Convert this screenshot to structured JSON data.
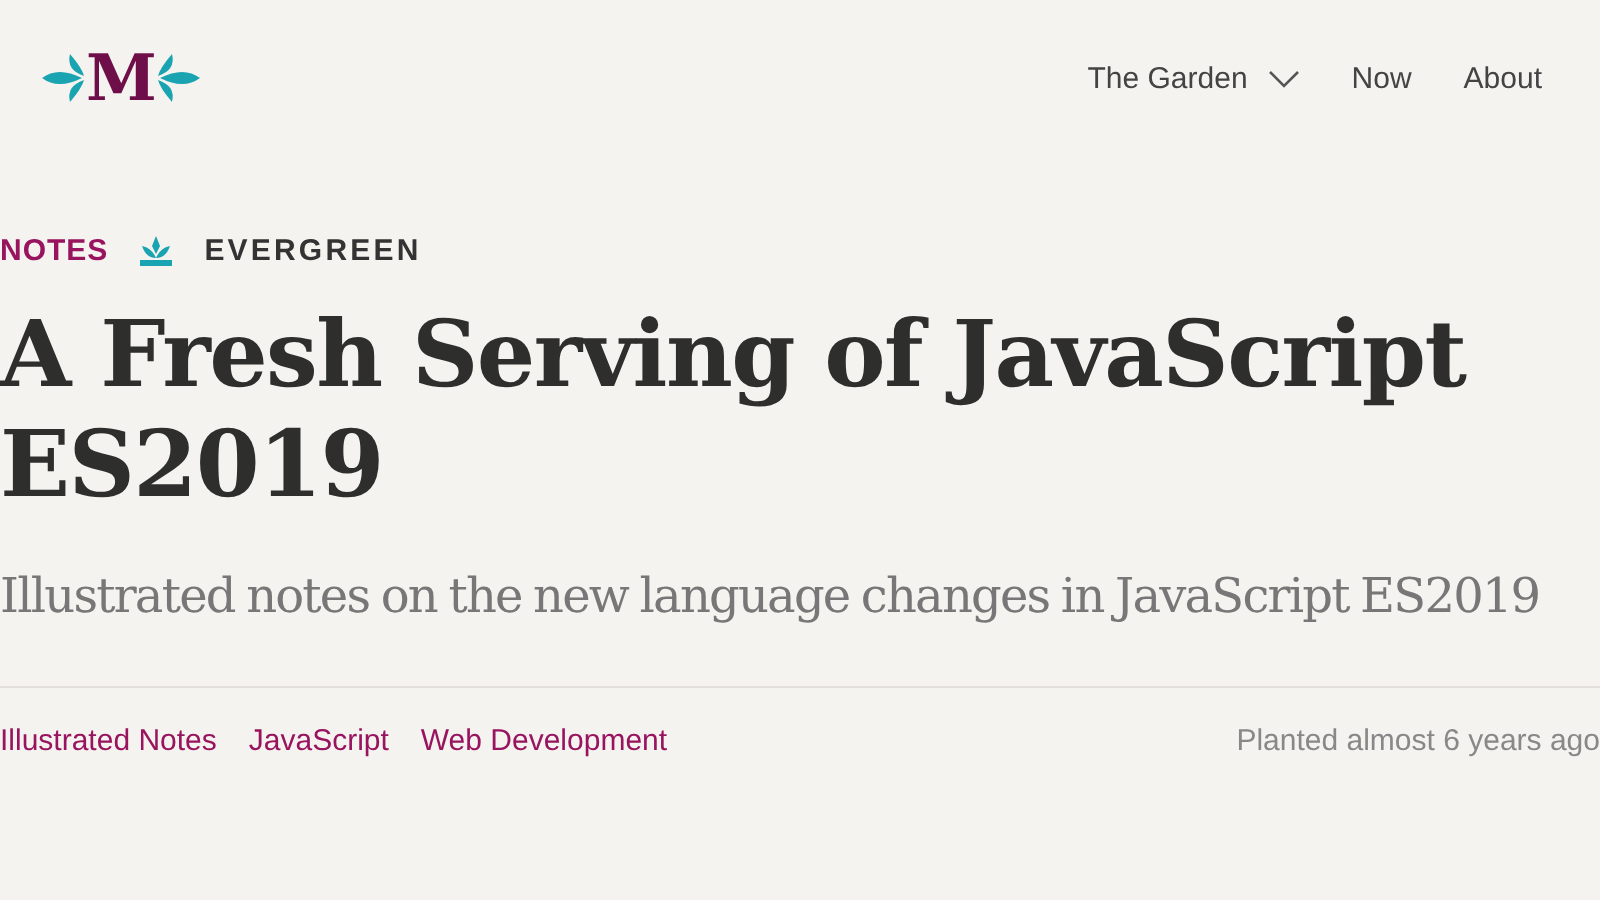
{
  "logo": {
    "letter": "M"
  },
  "nav": [
    {
      "label": "The Garden",
      "kind": "dropdown"
    },
    {
      "label": "Now",
      "kind": "link"
    },
    {
      "label": "About",
      "kind": "link"
    }
  ],
  "category": "NOTES",
  "growth_stage": "EVERGREEN",
  "title": "A Fresh Serving of JavaScript ES2019",
  "subtitle": "Illustrated notes on the new language changes in JavaScript ES2019",
  "topics": [
    "Illustrated Notes",
    "JavaScript",
    "Web Development"
  ],
  "planted": "Planted almost 6 years ago"
}
